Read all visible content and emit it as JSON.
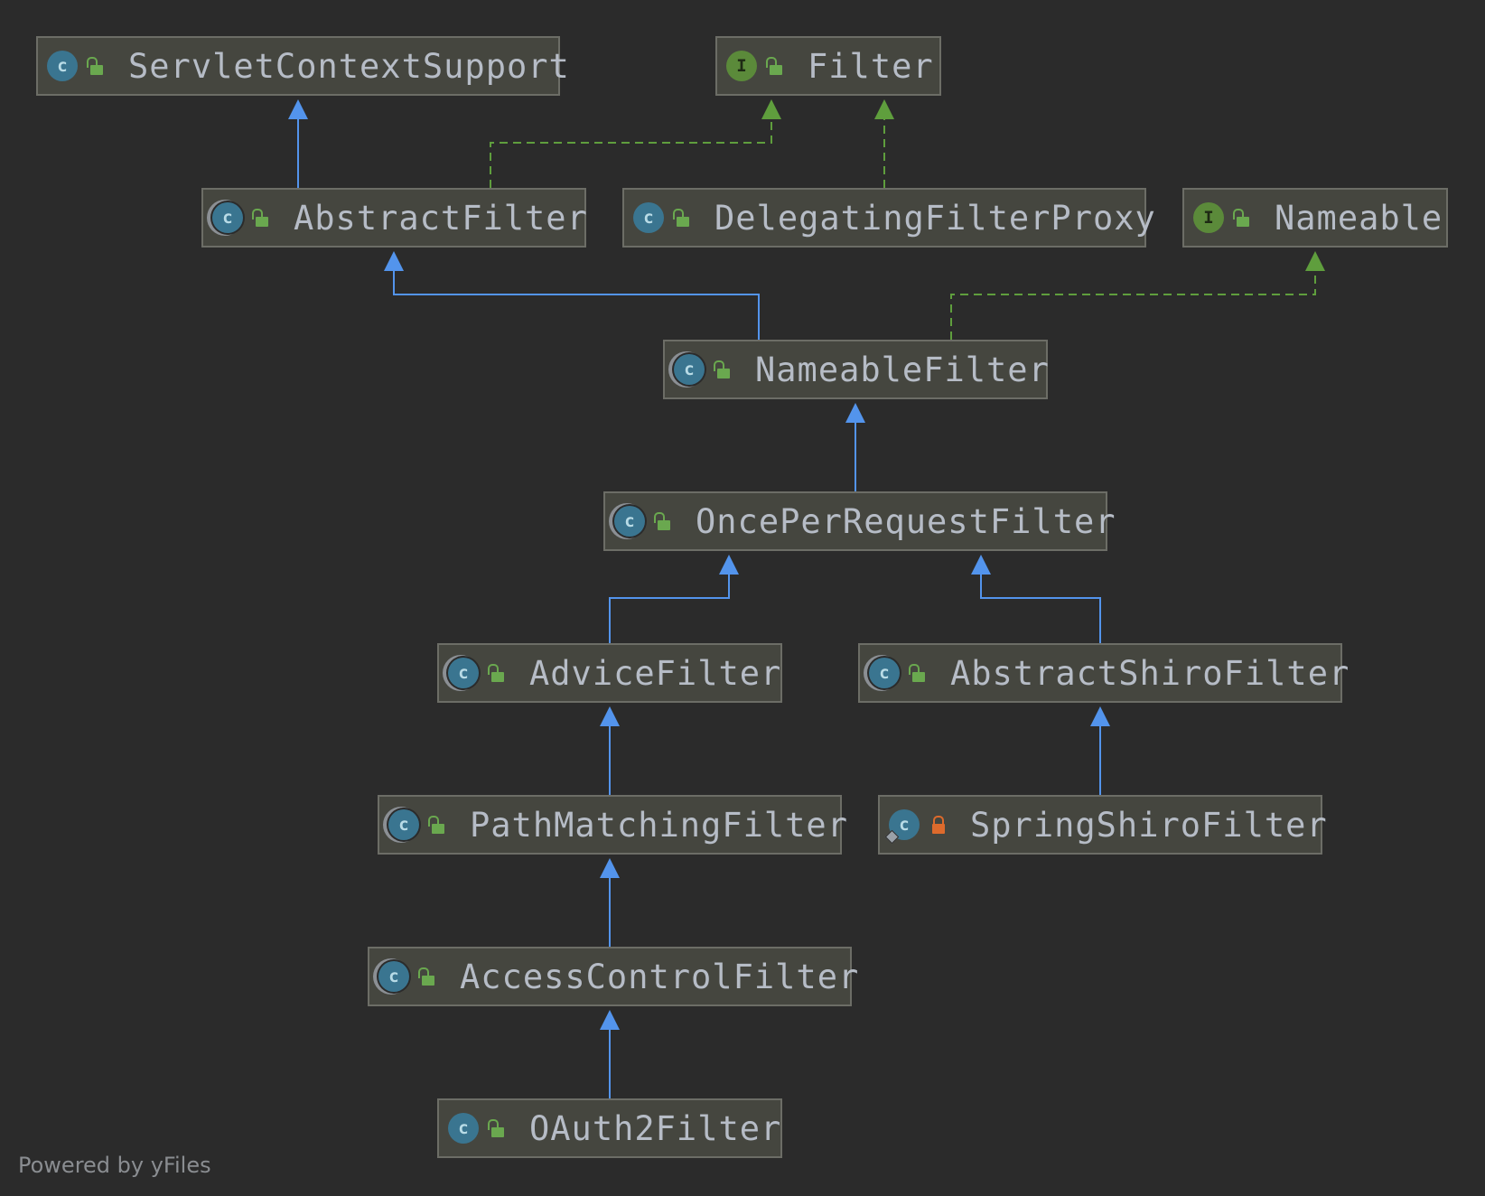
{
  "nodes": [
    {
      "id": "ServletContextSupport",
      "label": "ServletContextSupport",
      "kind": "class"
    },
    {
      "id": "Filter",
      "label": "Filter",
      "kind": "interface"
    },
    {
      "id": "AbstractFilter",
      "label": "AbstractFilter",
      "kind": "abstract"
    },
    {
      "id": "DelegatingFilterProxy",
      "label": "DelegatingFilterProxy",
      "kind": "class"
    },
    {
      "id": "Nameable",
      "label": "Nameable",
      "kind": "interface"
    },
    {
      "id": "NameableFilter",
      "label": "NameableFilter",
      "kind": "abstract"
    },
    {
      "id": "OncePerRequestFilter",
      "label": "OncePerRequestFilter",
      "kind": "abstract"
    },
    {
      "id": "AdviceFilter",
      "label": "AdviceFilter",
      "kind": "abstract"
    },
    {
      "id": "AbstractShiroFilter",
      "label": "AbstractShiroFilter",
      "kind": "abstract"
    },
    {
      "id": "PathMatchingFilter",
      "label": "PathMatchingFilter",
      "kind": "abstract"
    },
    {
      "id": "SpringShiroFilter",
      "label": "SpringShiroFilter",
      "kind": "class-annotated",
      "access": "private"
    },
    {
      "id": "AccessControlFilter",
      "label": "AccessControlFilter",
      "kind": "abstract"
    },
    {
      "id": "OAuth2Filter",
      "label": "OAuth2Filter",
      "kind": "class"
    }
  ],
  "edges": [
    {
      "from": "AbstractFilter",
      "to": "ServletContextSupport",
      "type": "extends"
    },
    {
      "from": "AbstractFilter",
      "to": "Filter",
      "type": "implements"
    },
    {
      "from": "DelegatingFilterProxy",
      "to": "Filter",
      "type": "implements"
    },
    {
      "from": "NameableFilter",
      "to": "AbstractFilter",
      "type": "extends"
    },
    {
      "from": "NameableFilter",
      "to": "Nameable",
      "type": "implements"
    },
    {
      "from": "OncePerRequestFilter",
      "to": "NameableFilter",
      "type": "extends"
    },
    {
      "from": "AdviceFilter",
      "to": "OncePerRequestFilter",
      "type": "extends"
    },
    {
      "from": "AbstractShiroFilter",
      "to": "OncePerRequestFilter",
      "type": "extends"
    },
    {
      "from": "PathMatchingFilter",
      "to": "AdviceFilter",
      "type": "extends"
    },
    {
      "from": "SpringShiroFilter",
      "to": "AbstractShiroFilter",
      "type": "extends"
    },
    {
      "from": "AccessControlFilter",
      "to": "PathMatchingFilter",
      "type": "extends"
    },
    {
      "from": "OAuth2Filter",
      "to": "AccessControlFilter",
      "type": "extends"
    }
  ],
  "colors": {
    "extends": "#5394ec",
    "implements": "#5f9e3d",
    "background": "#2b2b2b"
  },
  "footer": "Powered by yFiles"
}
